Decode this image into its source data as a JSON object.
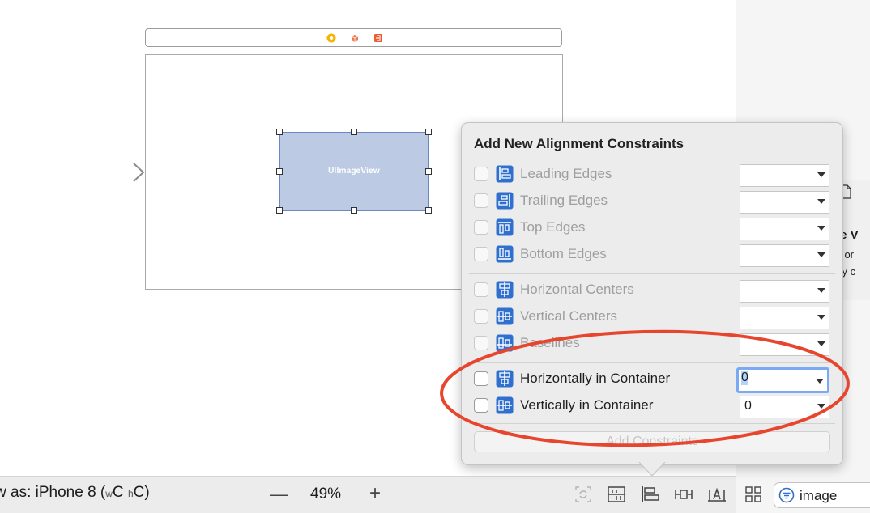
{
  "canvas": {
    "image_view_label": "UIImageView",
    "dock_icons": [
      "view-controller-icon",
      "first-responder-icon",
      "exit-icon"
    ]
  },
  "bottom_bar": {
    "view_as_prefix": "w as: iPhone 8 (",
    "w_size_class_small": "w",
    "w_size_class": "C",
    "h_size_class_small": "h",
    "h_size_class_suffix": "C)",
    "zoom_out": "—",
    "zoom_level": "49%",
    "zoom_in": "+",
    "tools": [
      "update-frames-icon",
      "embed-in-stack-icon",
      "align-icon",
      "pin-icon",
      "resolve-auto-layout-issues-icon"
    ]
  },
  "library": {
    "item_title": "ge V",
    "item_desc_line1": "e, or",
    "item_desc_line2": "ray c",
    "filter_text": "image"
  },
  "popover": {
    "title": "Add New Alignment Constraints",
    "rows": [
      {
        "label": "Leading Edges",
        "value": "",
        "enabled": false
      },
      {
        "label": "Trailing Edges",
        "value": "",
        "enabled": false
      },
      {
        "label": "Top Edges",
        "value": "",
        "enabled": false
      },
      {
        "label": "Bottom Edges",
        "value": "",
        "enabled": false
      },
      {
        "label": "Horizontal Centers",
        "value": "",
        "enabled": false
      },
      {
        "label": "Vertical Centers",
        "value": "",
        "enabled": false
      },
      {
        "label": "Baselines",
        "value": "",
        "enabled": false
      },
      {
        "label": "Horizontally in Container",
        "value": "0",
        "enabled": true
      },
      {
        "label": "Vertically in Container",
        "value": "0",
        "enabled": true
      }
    ],
    "add_button": "Add Constraints"
  },
  "colors": {
    "annotation": "#e8452f",
    "icon_blue": "#2f6fd0",
    "image_view_fill": "#bccbe3"
  }
}
